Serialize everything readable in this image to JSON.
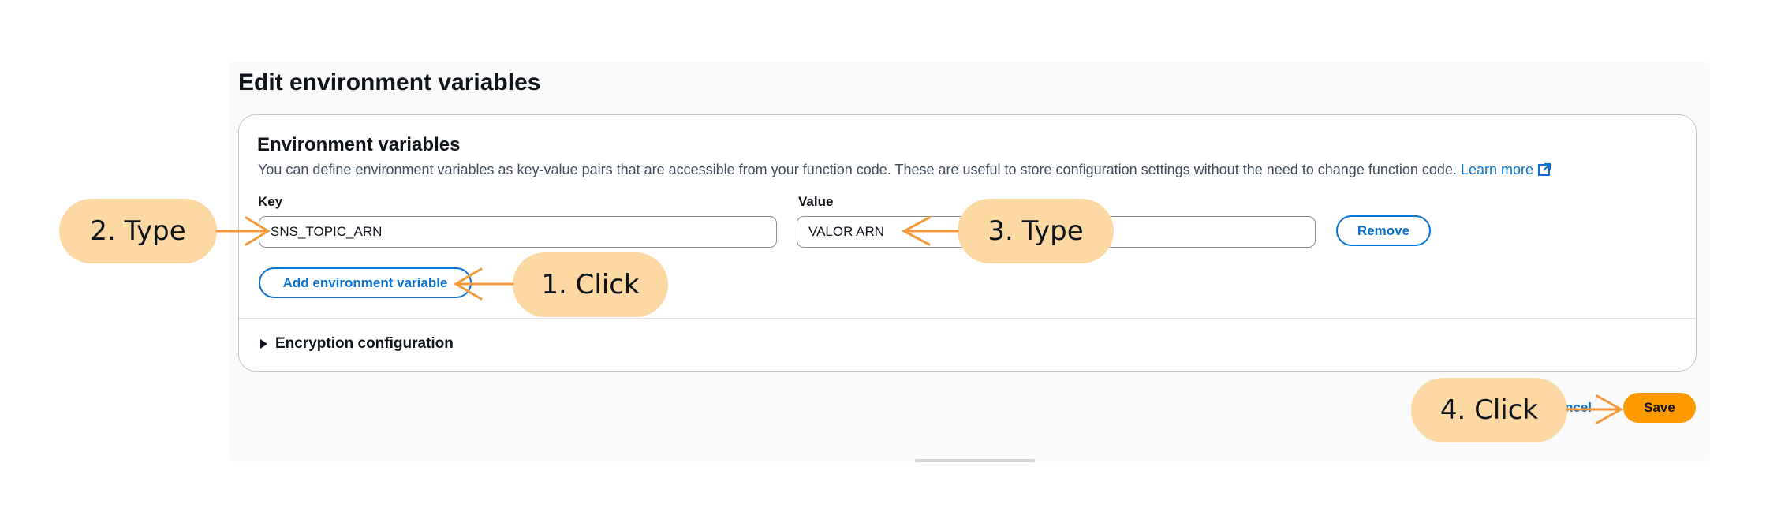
{
  "panel": {
    "title": "Edit environment variables"
  },
  "env": {
    "section_title": "Environment variables",
    "description": "You can define environment variables as key-value pairs that are accessible from your function code. These are useful to store configuration settings without the need to change function code.",
    "learn_more": "Learn more",
    "key_label": "Key",
    "value_label": "Value",
    "key_value": "SNS_TOPIC_ARN",
    "value_value": "VALOR ARN",
    "remove_label": "Remove",
    "add_label": "Add environment variable"
  },
  "encryption": {
    "label": "Encryption configuration"
  },
  "footer": {
    "cancel_label": "ncel",
    "save_label": "Save"
  },
  "annotations": {
    "step1": "1. Click",
    "step2": "2. Type",
    "step3": "3. Type",
    "step4": "4. Click"
  },
  "colors": {
    "callout_fill": "#fcd9a3",
    "arrow": "#f59a3c",
    "primary": "#ff9900",
    "link": "#0972d3"
  },
  "icons": {
    "external_link": "external-link-icon",
    "expander": "caret-right-icon"
  }
}
